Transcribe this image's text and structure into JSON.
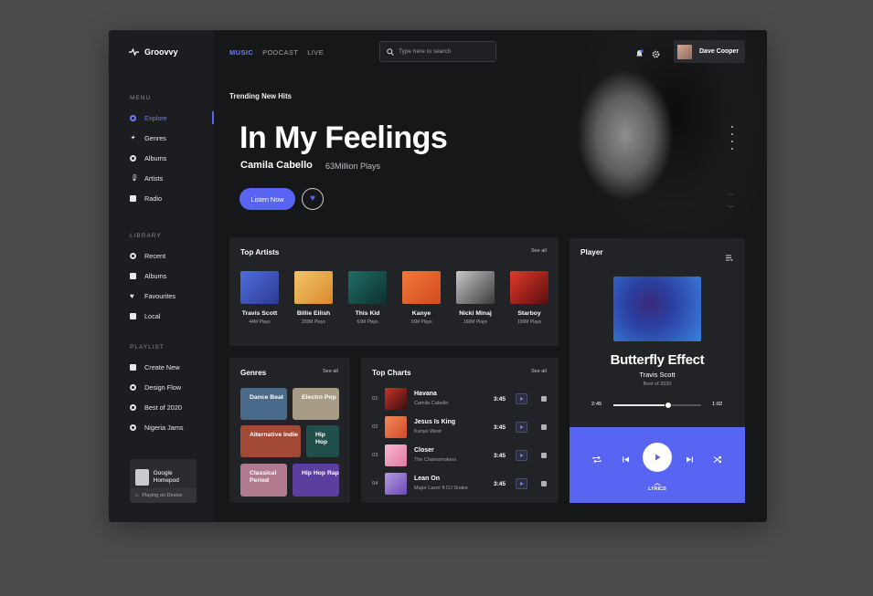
{
  "brand": {
    "name": "Groovvy"
  },
  "nav": {
    "tabs": [
      "MUSIC",
      "PODCAST",
      "LIVE"
    ]
  },
  "search": {
    "placeholder": "Type here to search"
  },
  "user": {
    "name": "Dave Cooper"
  },
  "sidebar": {
    "menu_label": "MENU",
    "menu": [
      "Explore",
      "Genres",
      "Albums",
      "Artists",
      "Radio"
    ],
    "library_label": "LIBRARY",
    "library": [
      "Recent",
      "Albums",
      "Favourites",
      "Local"
    ],
    "playlist_label": "PLAYLIST",
    "playlist": [
      "Create New",
      "Design Flow",
      "Best of 2020",
      "Nigeria Jams"
    ],
    "device": {
      "name": "Google Homepod",
      "status": "Playing on Device"
    }
  },
  "hero": {
    "subtitle": "Trending New Hits",
    "title": "In My Feelings",
    "artist": "Camila Cabello",
    "plays": "63Million Plays",
    "listen_label": "Listen Now"
  },
  "top_artists": {
    "title": "Top Artists",
    "see_all": "See all",
    "items": [
      {
        "name": "Travis Scott",
        "plays": "44M Plays"
      },
      {
        "name": "Billie Eilish",
        "plays": "203M Plays"
      },
      {
        "name": "This Kid",
        "plays": "63M Plays"
      },
      {
        "name": "Kanye",
        "plays": "16M Plays"
      },
      {
        "name": "Nicki Minaj",
        "plays": "160M Plays"
      },
      {
        "name": "Starboy",
        "plays": "100M Plays"
      }
    ]
  },
  "genres": {
    "title": "Genres",
    "see_all": "See all",
    "items": [
      "Dance Beat",
      "Electro Pop",
      "Alternative Indie",
      "Hip Hop",
      "Classical Period",
      "Hip Hop Rap"
    ]
  },
  "top_charts": {
    "title": "Top Charts",
    "see_all": "See all",
    "items": [
      {
        "num": "01",
        "title": "Havana",
        "artist": "Camila Cabello",
        "duration": "3:45"
      },
      {
        "num": "02",
        "title": "Jesus Is King",
        "artist": "Kanye West",
        "duration": "3:45"
      },
      {
        "num": "03",
        "title": "Closer",
        "artist": "The Chainsmokers",
        "duration": "3:45"
      },
      {
        "num": "04",
        "title": "Lean On",
        "artist": "Major Lazer ft DJ Snake",
        "duration": "3:45"
      }
    ]
  },
  "player": {
    "title": "Player",
    "song": "Butterfly Effect",
    "artist": "Travis Scott",
    "album": "Best of 2020",
    "current_time": "2:45",
    "total_time": "1:02",
    "progress": 0.62,
    "lyrics_label": "LYRICS"
  },
  "colors": {
    "accent": "#5865f2",
    "background": "#161719",
    "card": "#222326"
  }
}
